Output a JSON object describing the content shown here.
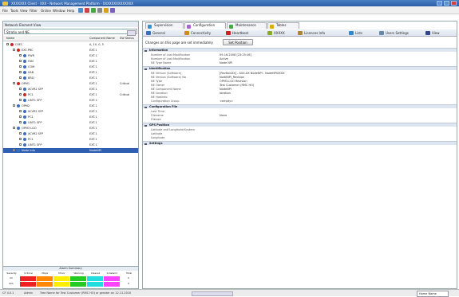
{
  "window": {
    "title": "XXXXXXX Client - XXX - Network Management Platform - XXXXXXXXXXXXXX"
  },
  "menu": {
    "items": [
      "File",
      "Tools",
      "View",
      "Filter",
      "Online",
      "Window",
      "Help"
    ]
  },
  "left_panel": {
    "title": "Network Element View",
    "search_value": "Stratix and NE",
    "columns": {
      "name": "Name",
      "id": "Component Name",
      "status": "SW Status"
    },
    "rows": [
      {
        "name": "CXEC",
        "id": "A, 10, 0, 5",
        "status": "",
        "depth": 0,
        "color": "#cc2222"
      },
      {
        "name": "EXT-PRC",
        "id": "EXT.1",
        "status": "",
        "depth": 1,
        "color": "#cc2222"
      },
      {
        "name": "PWR",
        "id": "EXT.1",
        "status": "",
        "depth": 2,
        "color": "#3a6fc0"
      },
      {
        "name": "FAN",
        "id": "EXT.1",
        "status": "",
        "depth": 2,
        "color": "#3a6fc0"
      },
      {
        "name": "COM",
        "id": "EXT.1",
        "status": "",
        "depth": 2,
        "color": "#3a6fc0"
      },
      {
        "name": "SAB",
        "id": "EXT.1",
        "status": "",
        "depth": 2,
        "color": "#3a6fc0"
      },
      {
        "name": "BRD",
        "id": "EXT.1",
        "status": "",
        "depth": 2,
        "color": "#3a6fc0"
      },
      {
        "name": "OPM1",
        "id": "EXT.1",
        "status": "Critical",
        "depth": 1,
        "color": "#cc2222"
      },
      {
        "name": "XCVR2 SFP",
        "id": "EXT.1",
        "status": "",
        "depth": 2,
        "color": "#3a6fc0"
      },
      {
        "name": "PC1",
        "id": "EXT.1",
        "status": "Critical",
        "depth": 2,
        "color": "#cc2222"
      },
      {
        "name": "LINT1 SFP",
        "id": "EXT.1",
        "status": "",
        "depth": 2,
        "color": "#3a6fc0"
      },
      {
        "name": "OPM2",
        "id": "EXT.1",
        "status": "",
        "depth": 1,
        "color": "#3a6fc0"
      },
      {
        "name": "XCVR2 SFP",
        "id": "EXT.1",
        "status": "",
        "depth": 2,
        "color": "#3a6fc0"
      },
      {
        "name": "PC1",
        "id": "EXT.1",
        "status": "",
        "depth": 2,
        "color": "#3a6fc0"
      },
      {
        "name": "LINT1 SFP",
        "id": "EXT.1",
        "status": "",
        "depth": 2,
        "color": "#3a6fc0"
      },
      {
        "name": "OPM3 LGO",
        "id": "EXT.1",
        "status": "",
        "depth": 1,
        "color": "#3a6fc0"
      },
      {
        "name": "XCVR2 SFP",
        "id": "EXT.1",
        "status": "",
        "depth": 2,
        "color": "#3a6fc0"
      },
      {
        "name": "PC1",
        "id": "EXT.1",
        "status": "",
        "depth": 2,
        "color": "#3a6fc0"
      },
      {
        "name": "LINT1 SFP",
        "id": "EXT.1",
        "status": "",
        "depth": 2,
        "color": "#3a6fc0"
      },
      {
        "name": "Node Info",
        "id": "NodeNPI",
        "status": "",
        "depth": 1,
        "color": "#3a6fc0",
        "selected": true
      }
    ]
  },
  "alarm_summary": {
    "title": "Alarm Summary",
    "headers": [
      "Severity",
      "Critical",
      "Major",
      "Minor",
      "Warning",
      "Cleared",
      "Indeterm",
      "Total"
    ],
    "row1": [
      "All",
      "",
      "",
      "",
      "",
      "",
      "",
      "0"
    ],
    "row2": [
      "N/A",
      "",
      "",
      "",
      "",
      "",
      "",
      "0"
    ],
    "colors": [
      "#ffffff",
      "#ee2222",
      "#ff8800",
      "#ffee00",
      "#22cc22",
      "#22dddd",
      "#ff44ff",
      "#ffffff"
    ]
  },
  "tabs": [
    {
      "label": "Supervision",
      "color": "#3a8fd0"
    },
    {
      "label": "Configuration",
      "color": "#aa66cc",
      "active": true
    },
    {
      "label": "Maintenance",
      "color": "#44aa44"
    },
    {
      "label": "Tables",
      "color": "#ddaa00"
    }
  ],
  "subtabs": [
    {
      "label": "General",
      "color": "#3a6fc0"
    },
    {
      "label": "Connectivity",
      "color": "#cc8822"
    },
    {
      "label": "Heartbeat",
      "color": "#cc2222"
    },
    {
      "label": "XXXXX",
      "color": "#88aa33"
    },
    {
      "label": "Licences Info",
      "color": "#aa8833"
    },
    {
      "label": "Lists",
      "color": "#3388cc"
    },
    {
      "label": "Users Settings",
      "color": "#6688aa"
    },
    {
      "label": "View",
      "color": "#334488"
    }
  ],
  "apply": {
    "message": "Changes on this page are set immediately",
    "button": "Set Position"
  },
  "sections": [
    {
      "title": "Information",
      "props": [
        {
          "k": "Number of Last Modification",
          "v": "09-16-2008 [23:25:16]"
        },
        {
          "k": "Number of Last Modification",
          "v": "Active"
        },
        {
          "k": "NE Type Name",
          "v": "Node NPI"
        }
      ]
    },
    {
      "title": "Identification",
      "props": [
        {
          "k": "NE Version (Software)",
          "v": "[RevNonXX] - XXX.XX NodeNPI - NodeNPIXXXX"
        },
        {
          "k": "NE Version (Software) No",
          "v": "NodeNPI_Revision"
        },
        {
          "k": "NE Type",
          "v": "OPM3-LGO Revision"
        },
        {
          "k": "NE Owner",
          "v": "Test Customer (RMC HO)"
        },
        {
          "k": "NE Component Name",
          "v": "NodeNPI"
        },
        {
          "k": "NE Location",
          "v": "location"
        },
        {
          "k": "NE Hostinfo",
          "v": ""
        },
        {
          "k": "Configuration Group",
          "v": "<empty>"
        }
      ]
    },
    {
      "title": "Configuration File",
      "props": [
        {
          "k": "Last Time",
          "v": ""
        },
        {
          "k": "Filename",
          "v": "None"
        },
        {
          "k": "Filesize",
          "v": ""
        }
      ]
    },
    {
      "title": "GPS Position",
      "props": [
        {
          "k": "Latitude and Longitude/System",
          "v": ""
        },
        {
          "k": "Latitude",
          "v": ""
        },
        {
          "k": "Longitude",
          "v": ""
        }
      ]
    },
    {
      "title": "Settings",
      "props": []
    }
  ],
  "statusbar": {
    "left": "CF 4.0.1",
    "user": "Admin",
    "info": "Tree Name for Test Customer (RMC HO) or greater on 12.11.2010",
    "right": "Home Name"
  }
}
